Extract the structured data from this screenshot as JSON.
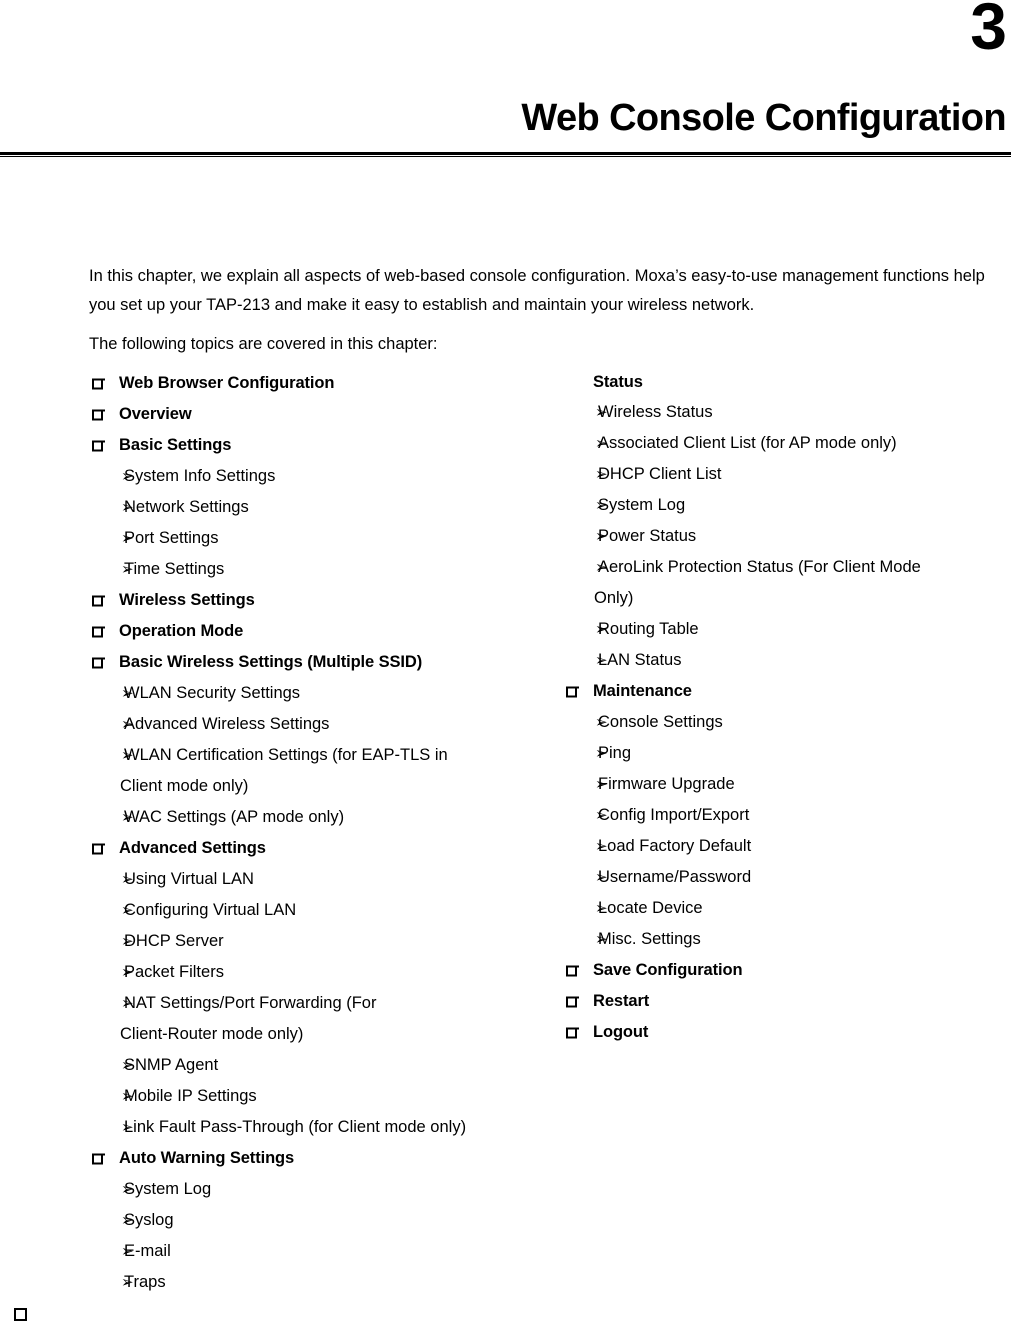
{
  "chapter": {
    "number": "3",
    "title": "Web Console Configuration"
  },
  "intro": {
    "paragraph1": "In this chapter, we explain all aspects of web-based console configuration. Moxa’s easy-to-use management functions help you set up your TAP-213 and make it easy to establish and maintain your wireless network.",
    "paragraph2": "The following topics are covered in this chapter:"
  },
  "icons": {
    "square_bullet": "square-bullet-icon",
    "arrow_bullet": "➢"
  },
  "toc": {
    "left_column": [
      {
        "type": "bullet",
        "label": "Web Browser Configuration"
      },
      {
        "type": "bullet",
        "label": "Overview"
      },
      {
        "type": "bullet",
        "label": "Basic Settings"
      },
      {
        "type": "arrow",
        "label": "System Info Settings"
      },
      {
        "type": "arrow",
        "label": "Network Settings"
      },
      {
        "type": "arrow",
        "label": "Port Settings"
      },
      {
        "type": "arrow",
        "label": "Time Settings"
      },
      {
        "type": "bullet",
        "label": "Wireless Settings"
      },
      {
        "type": "bullet",
        "label": "Operation Mode"
      },
      {
        "type": "bullet",
        "label": "Basic Wireless Settings (Multiple SSID)"
      },
      {
        "type": "arrow",
        "label": "WLAN Security Settings"
      },
      {
        "type": "arrow",
        "label": "Advanced Wireless Settings"
      },
      {
        "type": "arrow",
        "label": "WLAN Certification Settings (for EAP-TLS in"
      },
      {
        "type": "cont",
        "label": "Client mode only)"
      },
      {
        "type": "arrow",
        "label": "WAC Settings (AP mode only)"
      },
      {
        "type": "bullet",
        "label": "Advanced Settings"
      },
      {
        "type": "arrow",
        "label": "Using Virtual LAN"
      },
      {
        "type": "arrow",
        "label": "Configuring Virtual LAN"
      },
      {
        "type": "arrow",
        "label": "DHCP Server"
      },
      {
        "type": "arrow",
        "label": "Packet Filters"
      },
      {
        "type": "arrow",
        "label": "NAT Settings/Port Forwarding (For"
      },
      {
        "type": "cont",
        "label": "Client-Router mode only)"
      },
      {
        "type": "arrow",
        "label": "SNMP Agent"
      },
      {
        "type": "arrow",
        "label": "Mobile IP Settings"
      },
      {
        "type": "arrow",
        "label": "Link Fault Pass-Through (for Client mode only)"
      },
      {
        "type": "bullet",
        "label": "Auto Warning Settings"
      },
      {
        "type": "arrow",
        "label": "System Log"
      },
      {
        "type": "arrow",
        "label": "Syslog"
      },
      {
        "type": "arrow",
        "label": "E-mail"
      },
      {
        "type": "arrow",
        "label": "Traps"
      }
    ],
    "right_column": [
      {
        "type": "plainhead",
        "label": "Status"
      },
      {
        "type": "arrow",
        "label": "Wireless Status"
      },
      {
        "type": "arrow",
        "label": "Associated Client List (for AP mode only)"
      },
      {
        "type": "arrow",
        "label": "DHCP Client List"
      },
      {
        "type": "arrow",
        "label": "System Log"
      },
      {
        "type": "arrow",
        "label": "Power Status"
      },
      {
        "type": "arrow",
        "label": "AeroLink Protection Status (For Client Mode"
      },
      {
        "type": "cont",
        "label": "Only)"
      },
      {
        "type": "arrow",
        "label": "Routing Table"
      },
      {
        "type": "arrow",
        "label": "LAN Status"
      },
      {
        "type": "bullet",
        "label": "Maintenance"
      },
      {
        "type": "arrow",
        "label": "Console Settings"
      },
      {
        "type": "arrow",
        "label": "Ping"
      },
      {
        "type": "arrow",
        "label": "Firmware Upgrade"
      },
      {
        "type": "arrow",
        "label": "Config Import/Export"
      },
      {
        "type": "arrow",
        "label": "Load Factory Default"
      },
      {
        "type": "arrow",
        "label": "Username/Password"
      },
      {
        "type": "arrow",
        "label": "Locate Device"
      },
      {
        "type": "arrow",
        "label": "Misc. Settings"
      },
      {
        "type": "bullet",
        "label": "Save Configuration"
      },
      {
        "type": "bullet",
        "label": "Restart"
      },
      {
        "type": "bullet",
        "label": "Logout"
      }
    ]
  }
}
